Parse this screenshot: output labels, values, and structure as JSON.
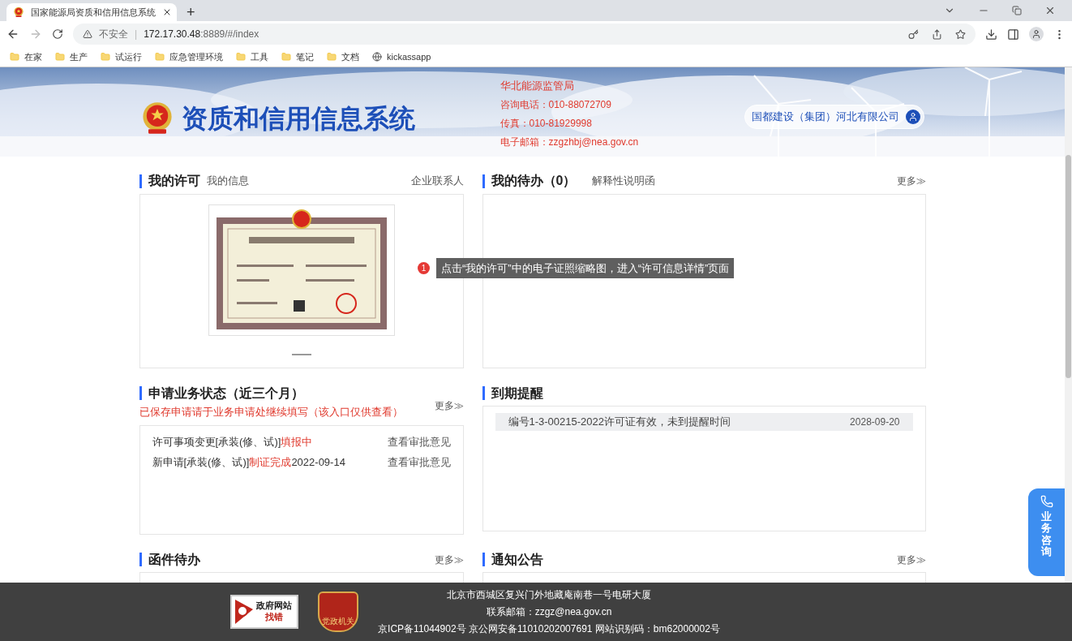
{
  "browser": {
    "tab": {
      "title": "国家能源局资质和信用信息系统",
      "selected": true
    },
    "new_tab": "+",
    "address": {
      "warning": "不安全",
      "separator": "|",
      "host": "172.17.30.48",
      "path": ":8889/#/index"
    },
    "bookmarks": [
      {
        "label": "在家",
        "kind": "folder"
      },
      {
        "label": "生产",
        "kind": "folder"
      },
      {
        "label": "试运行",
        "kind": "folder"
      },
      {
        "label": "应急管理环境",
        "kind": "folder"
      },
      {
        "label": "工具",
        "kind": "folder"
      },
      {
        "label": "笔记",
        "kind": "folder"
      },
      {
        "label": "文档",
        "kind": "folder"
      },
      {
        "label": "kickassapp",
        "kind": "site"
      }
    ]
  },
  "header": {
    "title": "资质和信用信息系统",
    "agency": "华北能源监管局",
    "contacts": [
      "咨询电话：010-88072709",
      "传真：010-81929998",
      "电子邮箱：zzgzhbj@nea.gov.cn"
    ],
    "user": "国都建设（集团）河北有限公司"
  },
  "license": {
    "title": "我的许可",
    "tab": "我的信息",
    "link": "企业联系人"
  },
  "todo": {
    "title": "我的待办（0）",
    "tab": "解释性说明函",
    "more": "更多≫"
  },
  "applications": {
    "title": "申请业务状态（近三个月）",
    "note": "已保存申请请于业务申请处继续填写（该入口仅供查看）",
    "more": "更多≫",
    "rows": [
      {
        "item": "许可事项变更[承装(修、试)]",
        "status": "填报中",
        "date": "",
        "action": "查看审批意见"
      },
      {
        "item": "新申请[承装(修、试)]",
        "status": "制证完成",
        "date": "2022-09-14",
        "action": "查看审批意见"
      }
    ]
  },
  "expiry": {
    "title": "到期提醒",
    "rows": [
      {
        "text": "编号1-3-00215-2022许可证有效，未到提醒时间",
        "date": "2028-09-20"
      }
    ]
  },
  "letters": {
    "title": "函件待办",
    "more": "更多≫"
  },
  "notices": {
    "title": "通知公告",
    "more": "更多≫"
  },
  "tip": {
    "badge": "1",
    "text": "点击“我的许可”中的电子证照缩略图，进入“许可信息详情”页面"
  },
  "consult": "业务咨询",
  "footer": {
    "report_badge": [
      "政府网站",
      "找错"
    ],
    "party_badge": "党政机关",
    "lines": [
      "北京市西城区复兴门外地藏庵南巷一号电研大厦",
      "联系邮箱：zzgz@nea.gov.cn",
      "京ICP备11044902号 京公网安备11010202007691 网站识别码：bm62000002号"
    ]
  }
}
